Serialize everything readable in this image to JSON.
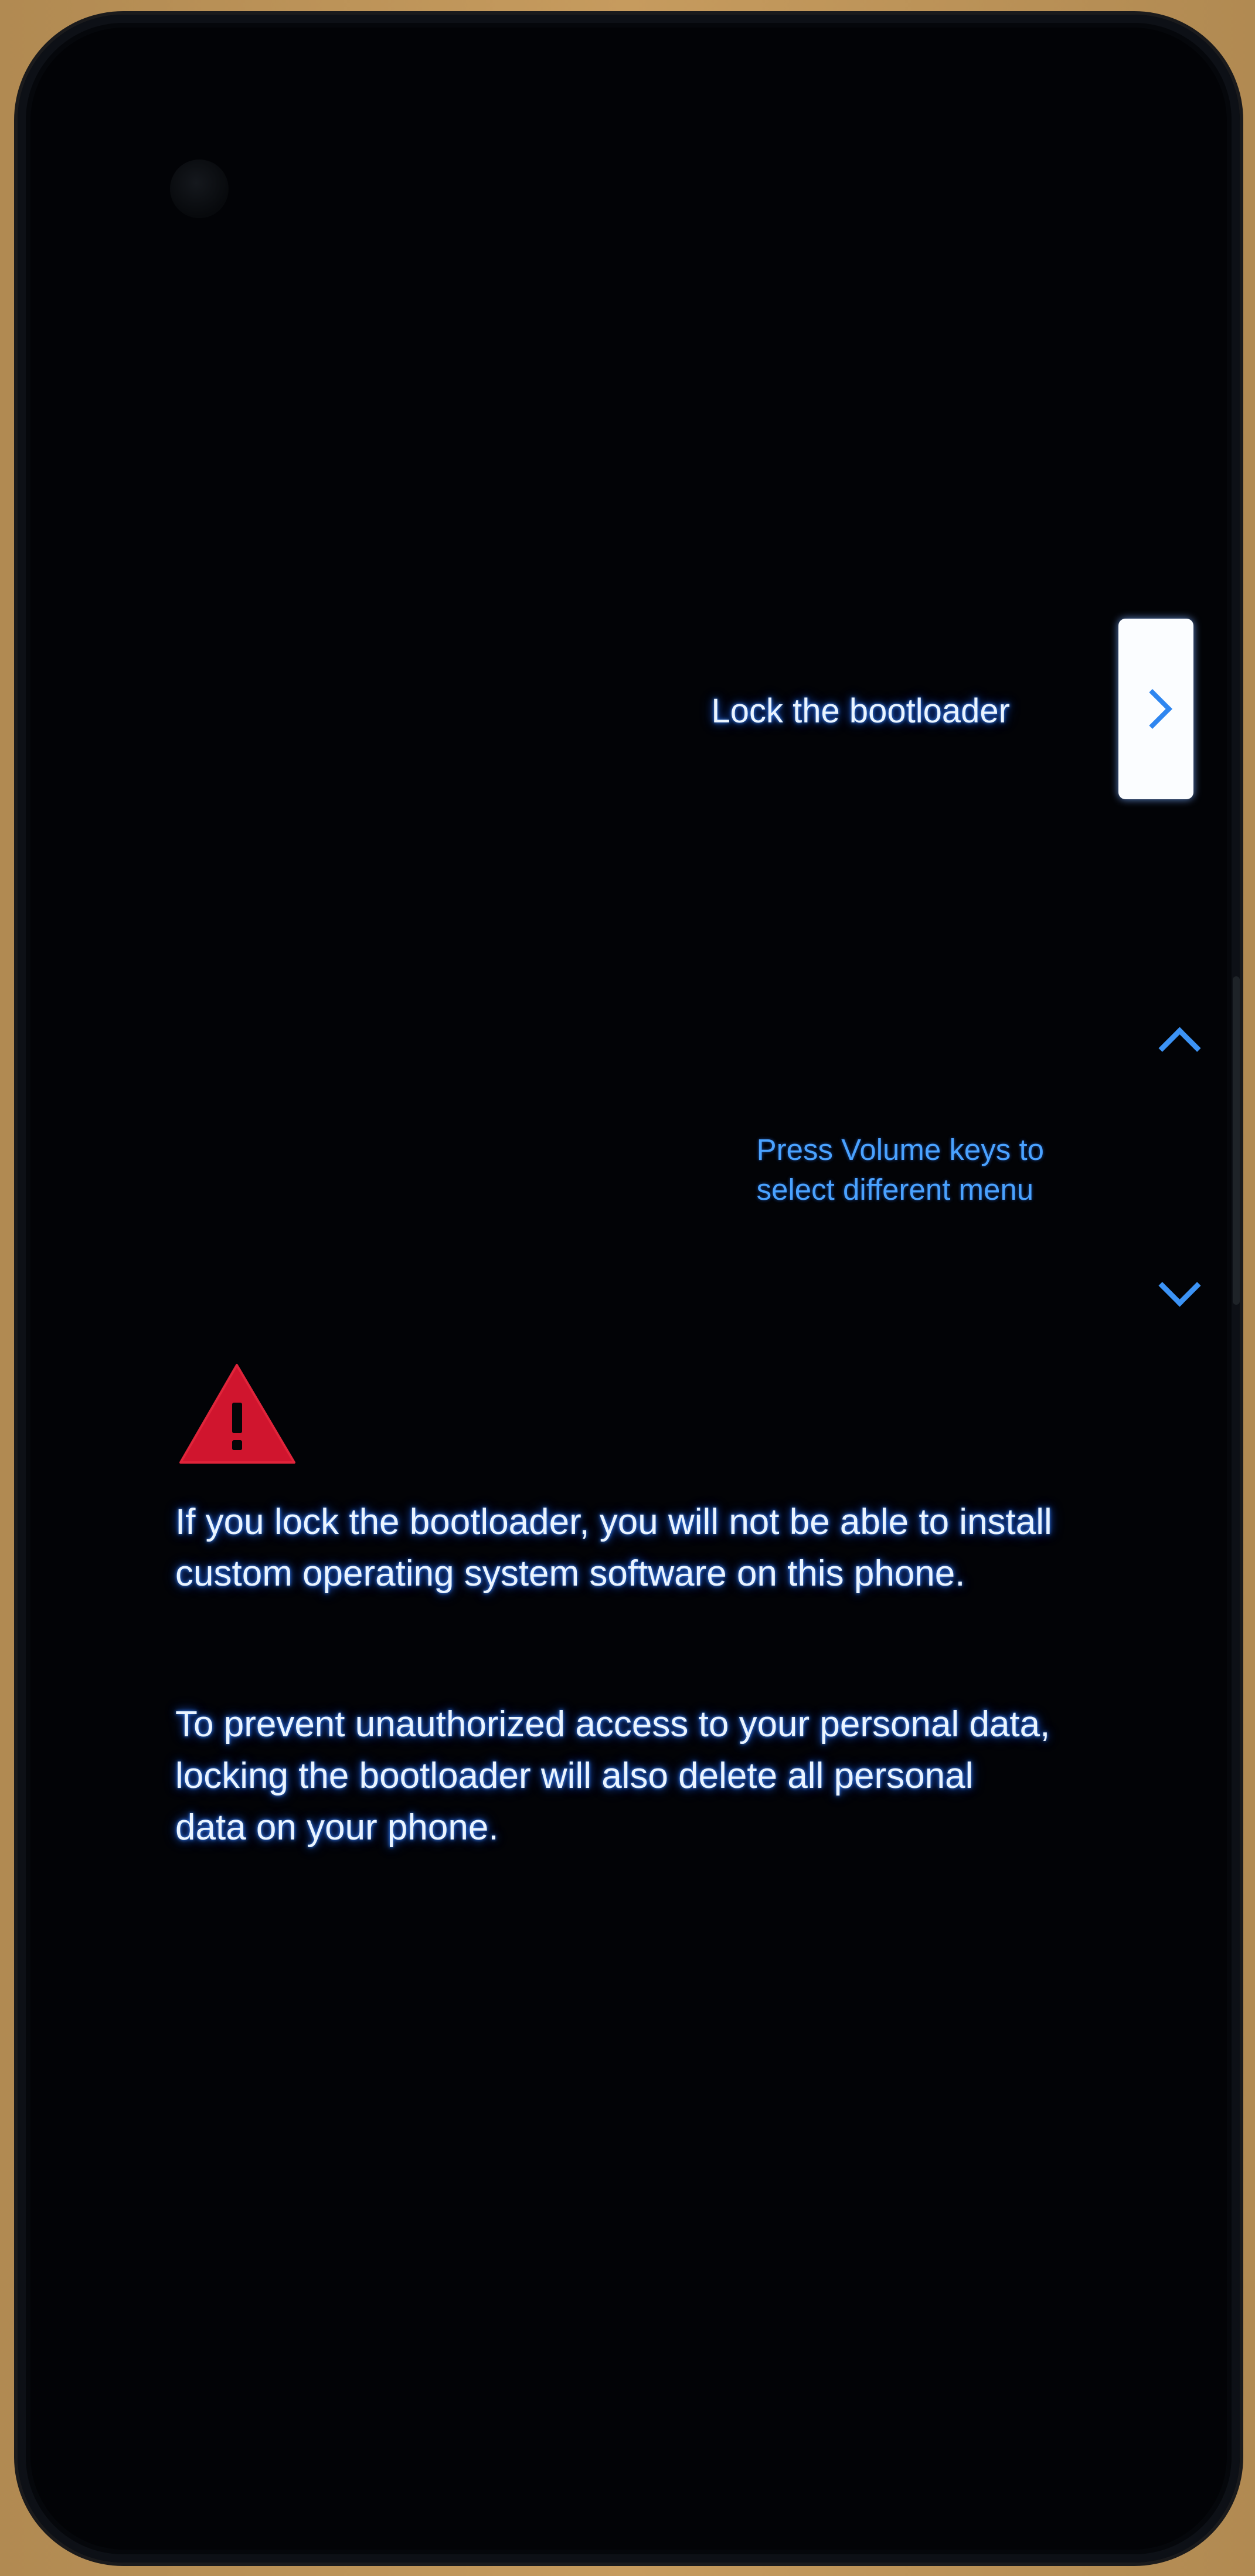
{
  "menu": {
    "selected_option": "Lock the bootloader"
  },
  "hint": {
    "line1": "Press Volume keys to",
    "line2": "select different menu"
  },
  "warning": {
    "paragraph1": {
      "line1": "If you lock the bootloader, you will not be able to install",
      "line2": "custom operating system software on this phone."
    },
    "paragraph2": {
      "line1": "To prevent unauthorized access to your personal data,",
      "line2": "locking the bootloader will also delete all personal",
      "line3": "data on your phone."
    }
  },
  "icons": {
    "power": "chevron-right-icon",
    "volume_up": "chevron-up-icon",
    "volume_down": "chevron-down-icon",
    "warning": "warning-triangle-icon"
  },
  "colors": {
    "screen_background": "#020306",
    "text": "#eaf4ff",
    "text_glow": "#2f6fff",
    "accent_blue": "#3c93f5",
    "warning_red": "#d0152e"
  }
}
